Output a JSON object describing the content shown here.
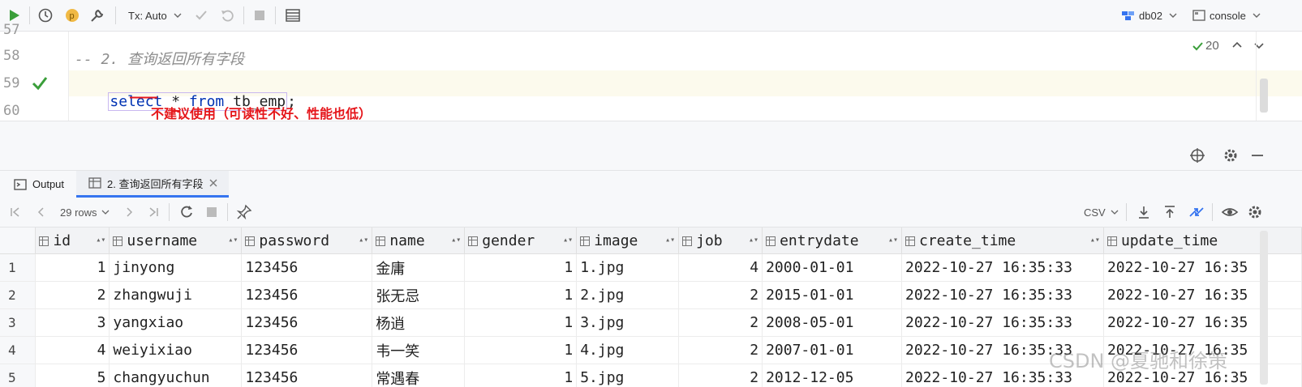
{
  "toolbar": {
    "tx_mode": "Tx: Auto",
    "datasource": "db02",
    "session": "console"
  },
  "editor": {
    "lines": [
      {
        "number": "57",
        "text": ""
      },
      {
        "number": "58",
        "text": "-- 2. 查询返回所有字段"
      },
      {
        "number": "59",
        "text": "select * from tb_emp;"
      },
      {
        "number": "60",
        "text": ""
      }
    ],
    "kw_select": "select",
    "star": "*",
    "kw_from": "from",
    "table_name": "tb_emp",
    "semicolon": ";",
    "comment": "-- 2. 查询返回所有字段",
    "annotation": "不建议使用（可读性不好、性能也低）",
    "inspection_count": "20"
  },
  "tabs": {
    "output": "Output",
    "result": "2. 查询返回所有字段"
  },
  "gridbar": {
    "rows_label": "29 rows",
    "export_format": "CSV"
  },
  "table": {
    "columns": [
      "id",
      "username",
      "password",
      "name",
      "gender",
      "image",
      "job",
      "entrydate",
      "create_time",
      "update_time"
    ],
    "rows": [
      [
        "1",
        "1",
        "jinyong",
        "123456",
        "金庸",
        "1",
        "1.jpg",
        "4",
        "2000-01-01",
        "2022-10-27 16:35:33",
        "2022-10-27 16:35"
      ],
      [
        "2",
        "2",
        "zhangwuji",
        "123456",
        "张无忌",
        "1",
        "2.jpg",
        "2",
        "2015-01-01",
        "2022-10-27 16:35:33",
        "2022-10-27 16:35"
      ],
      [
        "3",
        "3",
        "yangxiao",
        "123456",
        "杨逍",
        "1",
        "3.jpg",
        "2",
        "2008-05-01",
        "2022-10-27 16:35:33",
        "2022-10-27 16:35"
      ],
      [
        "4",
        "4",
        "weiyixiao",
        "123456",
        "韦一笑",
        "1",
        "4.jpg",
        "2",
        "2007-01-01",
        "2022-10-27 16:35:33",
        "2022-10-27 16:35"
      ],
      [
        "5",
        "5",
        "changyuchun",
        "123456",
        "常遇春",
        "1",
        "5.jpg",
        "2",
        "2012-12-05",
        "2022-10-27 16:35:33",
        "2022-10-27 16:35"
      ]
    ]
  },
  "watermark": "CSDN @夏驰和徐策",
  "colors": {
    "keyword": "#0033b3",
    "annotation": "#e5161b",
    "accent": "#3574f0",
    "run_green": "#3a9e3a"
  }
}
